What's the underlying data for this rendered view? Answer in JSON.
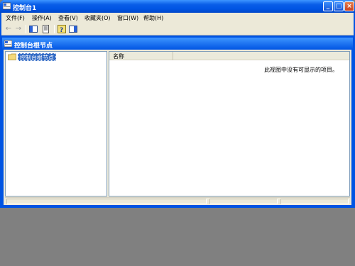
{
  "window": {
    "title": "控制台1"
  },
  "menu": [
    {
      "label": "文件(F)"
    },
    {
      "label": "操作(A)"
    },
    {
      "label": "查看(V)"
    },
    {
      "label": "收藏夹(O)"
    },
    {
      "label": "窗口(W)"
    },
    {
      "label": "帮助(H)"
    }
  ],
  "child": {
    "title": "控制台根节点"
  },
  "tree": {
    "root_label": "控制台根节点"
  },
  "list": {
    "column_name": "名称",
    "empty_message": "此视图中没有可显示的项目。"
  },
  "colors": {
    "title_blue": "#0054e3",
    "face": "#ece9d8",
    "desktop": "#808080",
    "selection": "#316ac5"
  },
  "icons": [
    "back-icon",
    "forward-icon",
    "show-hide-tree-icon",
    "properties-icon",
    "help-icon",
    "show-hide-action-pane-icon"
  ]
}
